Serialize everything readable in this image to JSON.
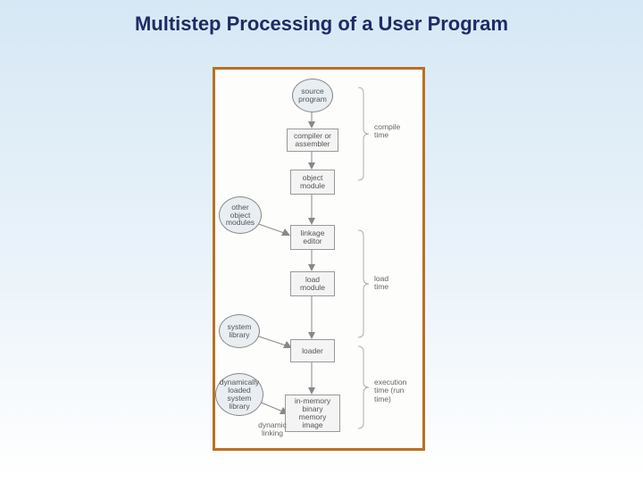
{
  "title": "Multistep Processing of a User Program",
  "nodes": {
    "source_program": "source\nprogram",
    "compiler": "compiler or\nassembler",
    "object_module": "object\nmodule",
    "linkage_editor": "linkage\neditor",
    "load_module": "load\nmodule",
    "loader": "loader",
    "memory_image": "in-memory\nbinary\nmemory\nimage",
    "other_obj": "other\nobject\nmodules",
    "system_library": "system\nlibrary",
    "dyn_library": "dynamically\nloaded\nsystem\nlibrary"
  },
  "side_labels": {
    "dynamic_linking": "dynamic\nlinking",
    "compile_time": "compile\ntime",
    "load_time": "load\ntime",
    "exec_time": "execution\ntime (run\ntime)"
  }
}
